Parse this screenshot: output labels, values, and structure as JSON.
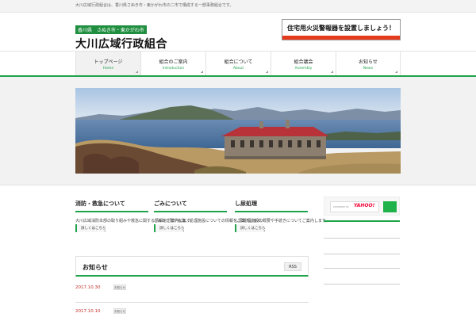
{
  "topbar": {
    "tagline": "大川広域行政組合は、香川県さぬき市・東かがわ市の二市で構成する一部事務組合です。"
  },
  "header": {
    "logo_sub": "香川県　さぬき市・東かがわ市",
    "logo_main": "大川広域行政組合",
    "banner_text": "住宅用火災警報器を設置しましょう！"
  },
  "nav": {
    "items": [
      {
        "jp": "トップページ",
        "en": "Home"
      },
      {
        "jp": "組合のご案内",
        "en": "Introduction"
      },
      {
        "jp": "組合について",
        "en": "About"
      },
      {
        "jp": "組合議会",
        "en": "Assembly"
      },
      {
        "jp": "お知らせ",
        "en": "News"
      }
    ]
  },
  "columns": [
    {
      "title": "消防・救急について",
      "body": "大川広域消防本部の取り組みや救急に関する情報をご案内します。",
      "button": "詳しくはこちら"
    },
    {
      "title": "ごみについて",
      "body": "ごみの分別や収集、処理施設についての情報をご案内します。",
      "button": "詳しくはこちら"
    },
    {
      "title": "し尿処理",
      "body": "し尿処理施設の概要や手続きについてご案内します。",
      "button": "詳しくはこちら"
    }
  ],
  "sidebar": {
    "powered_by": "POWERED BY",
    "search_brand": "YAHOO!"
  },
  "news": {
    "title": "お知らせ",
    "rss_label": "RSS",
    "items": [
      {
        "date": "2017.10.30",
        "badge": "お知らせ"
      },
      {
        "date": "2017.10.10",
        "badge": "お知らせ"
      }
    ]
  },
  "colors": {
    "accent": "#1fa34a",
    "banner_red": "#e63a1c",
    "date_red": "#c0302a"
  }
}
